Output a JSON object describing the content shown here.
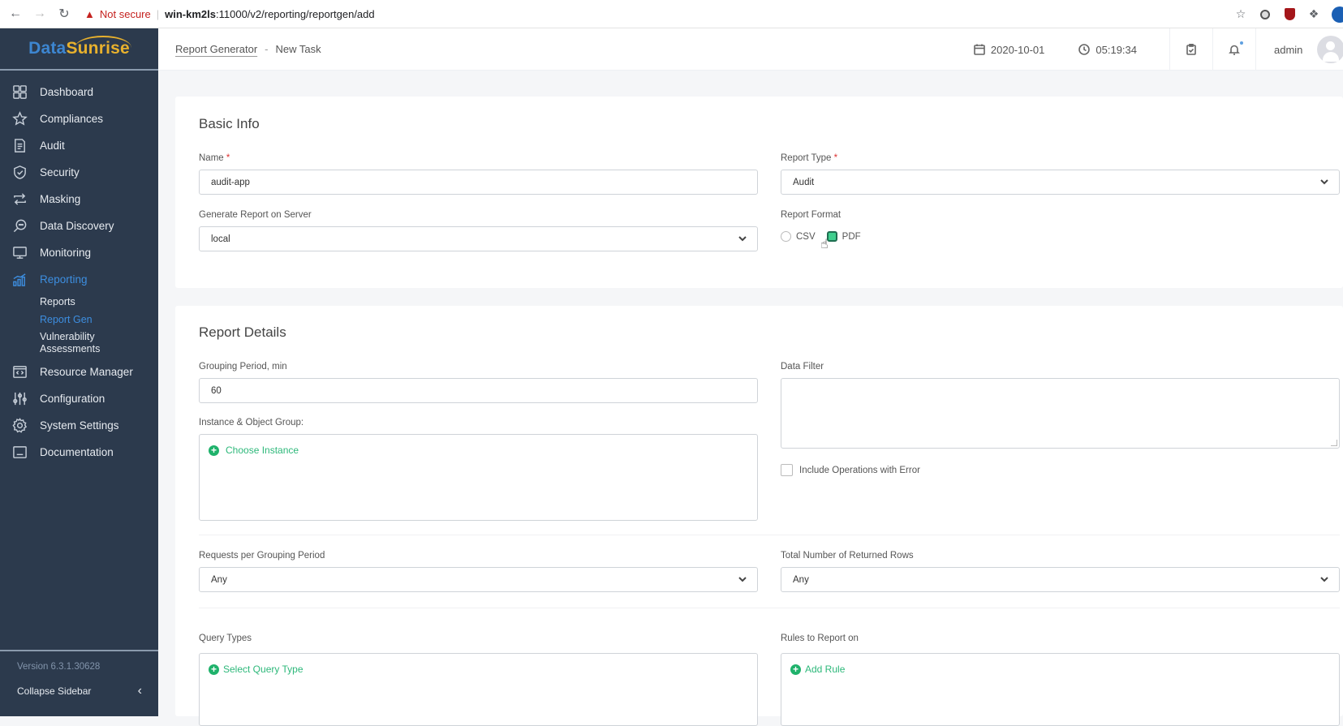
{
  "browser": {
    "security_label": "Not secure",
    "url_host": "win-km2ls",
    "url_rest": ":11000/v2/reporting/reportgen/add"
  },
  "sidebar": {
    "logo_part1": "Data",
    "logo_part2": "Sunrise",
    "items": [
      {
        "label": "Dashboard",
        "icon": "grid-icon"
      },
      {
        "label": "Compliances",
        "icon": "star-icon"
      },
      {
        "label": "Audit",
        "icon": "document-icon"
      },
      {
        "label": "Security",
        "icon": "shield-icon"
      },
      {
        "label": "Masking",
        "icon": "swap-icon"
      },
      {
        "label": "Data Discovery",
        "icon": "search-chat-icon"
      },
      {
        "label": "Monitoring",
        "icon": "monitor-icon"
      },
      {
        "label": "Reporting",
        "icon": "chart-icon",
        "active": true
      }
    ],
    "sub_items": [
      {
        "label": "Reports"
      },
      {
        "label": "Report Gen",
        "active": true
      },
      {
        "label": "Vulnerability Assessments"
      }
    ],
    "items_after": [
      {
        "label": "Resource Manager",
        "icon": "code-window-icon"
      },
      {
        "label": "Configuration",
        "icon": "sliders-icon"
      },
      {
        "label": "System Settings",
        "icon": "gear-icon"
      },
      {
        "label": "Documentation",
        "icon": "doc-icon"
      }
    ],
    "version": "Version 6.3.1.30628",
    "collapse_label": "Collapse Sidebar"
  },
  "header": {
    "breadcrumb_link": "Report Generator",
    "breadcrumb_sep": "-",
    "breadcrumb_current": "New Task",
    "date": "2020-10-01",
    "time": "05:19:34",
    "user": "admin"
  },
  "basic_info": {
    "title": "Basic Info",
    "name_label": "Name",
    "name_value": "audit-app",
    "report_type_label": "Report Type",
    "report_type_value": "Audit",
    "server_label": "Generate Report on Server",
    "server_value": "local",
    "format_label": "Report Format",
    "format_options": [
      "CSV",
      "PDF"
    ],
    "format_selected": "PDF",
    "required_mark": "*"
  },
  "report_details": {
    "title": "Report Details",
    "grouping_label": "Grouping Period, min",
    "grouping_value": "60",
    "data_filter_label": "Data Filter",
    "data_filter_value": "",
    "instance_label": "Instance & Object Group:",
    "choose_instance": "Choose Instance",
    "include_errors_label": "Include Operations with Error",
    "include_errors_checked": false,
    "requests_label": "Requests per Grouping Period",
    "requests_value": "Any",
    "rows_label": "Total Number of Returned Rows",
    "rows_value": "Any",
    "query_types_label": "Query Types",
    "select_query_type": "Select Query Type",
    "rules_label": "Rules to Report on",
    "add_rule": "Add Rule"
  },
  "colors": {
    "sidebar_bg": "#2c3a4d",
    "accent_blue": "#3d8ee0",
    "accent_green": "#2db87a",
    "logo_yellow": "#e8b12d"
  }
}
